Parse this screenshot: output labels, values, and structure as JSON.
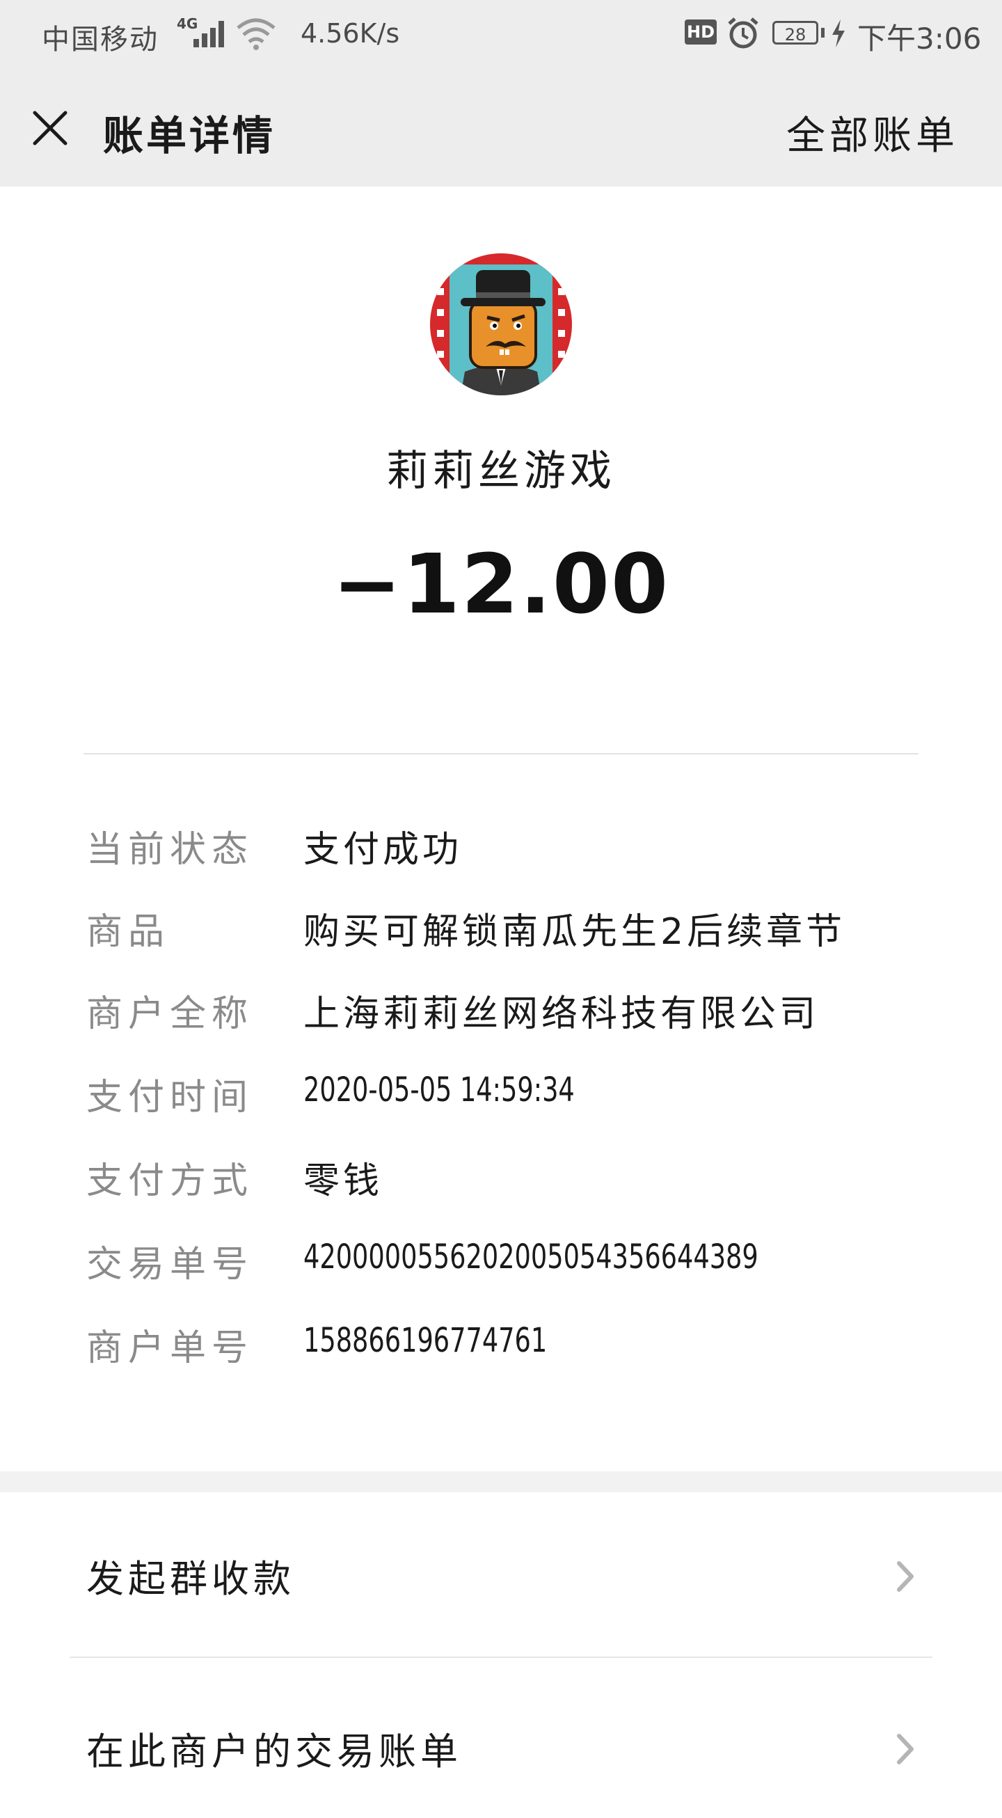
{
  "status_bar": {
    "carrier": "中国移动",
    "network": "4G",
    "speed": "4.56K/s",
    "hd": "HD",
    "battery": "28",
    "time": "下午3:06"
  },
  "nav": {
    "title": "账单详情",
    "all_bills": "全部账单"
  },
  "merchant": {
    "name": "莉莉丝游戏",
    "amount": "−12.00"
  },
  "details": [
    {
      "label": "当前状态",
      "value": "支付成功"
    },
    {
      "label": "商品",
      "value": "购买可解锁南瓜先生2后续章节"
    },
    {
      "label": "商户全称",
      "value": "上海莉莉丝网络科技有限公司"
    },
    {
      "label": "支付时间",
      "value": "2020-05-05 14:59:34"
    },
    {
      "label": "支付方式",
      "value": "零钱"
    },
    {
      "label": "交易单号",
      "value": "4200000556202005054356644389"
    },
    {
      "label": "商户单号",
      "value": "158866196774761"
    }
  ],
  "actions": [
    {
      "label": "发起群收款"
    },
    {
      "label": "在此商户的交易账单"
    }
  ],
  "icons": {
    "close": "close-icon",
    "chevron": "chevron-right-icon",
    "avatar": "mr-pumpkin-avatar"
  }
}
